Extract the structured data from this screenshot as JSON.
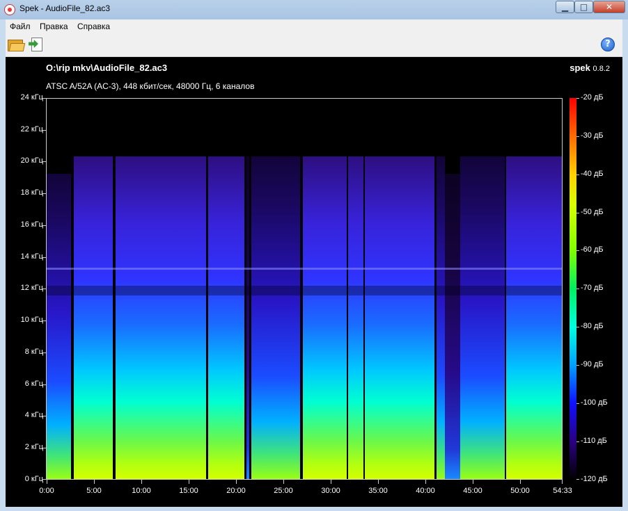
{
  "window": {
    "title": "Spek - AudioFile_82.ac3"
  },
  "menu": {
    "items": [
      "Файл",
      "Правка",
      "Справка"
    ]
  },
  "toolbar": {
    "help_label": "?"
  },
  "spectrogram": {
    "file_title": "O:\\rip mkv\\AudioFile_82.ac3",
    "brand": "spek",
    "version": "0.8.2",
    "info": "ATSC A/52A (AC-3), 448 кбит/сек, 48000 Гц, 6 каналов",
    "y_ticks": [
      "24 кГц",
      "22 кГц",
      "20 кГц",
      "18 кГц",
      "16 кГц",
      "14 кГц",
      "12 кГц",
      "10 кГц",
      "8 кГц",
      "6 кГц",
      "4 кГц",
      "2 кГц",
      "0 кГц"
    ],
    "x_ticks": [
      "0:00",
      "5:00",
      "10:00",
      "15:00",
      "20:00",
      "25:00",
      "30:00",
      "35:00",
      "40:00",
      "45:00",
      "50:00",
      "54:33"
    ],
    "db_ticks": [
      "-20 дБ",
      "-30 дБ",
      "-40 дБ",
      "-50 дБ",
      "-60 дБ",
      "-70 дБ",
      "-80 дБ",
      "-90 дБ",
      "-100 дБ",
      "-110 дБ",
      "-120 дБ"
    ]
  }
}
